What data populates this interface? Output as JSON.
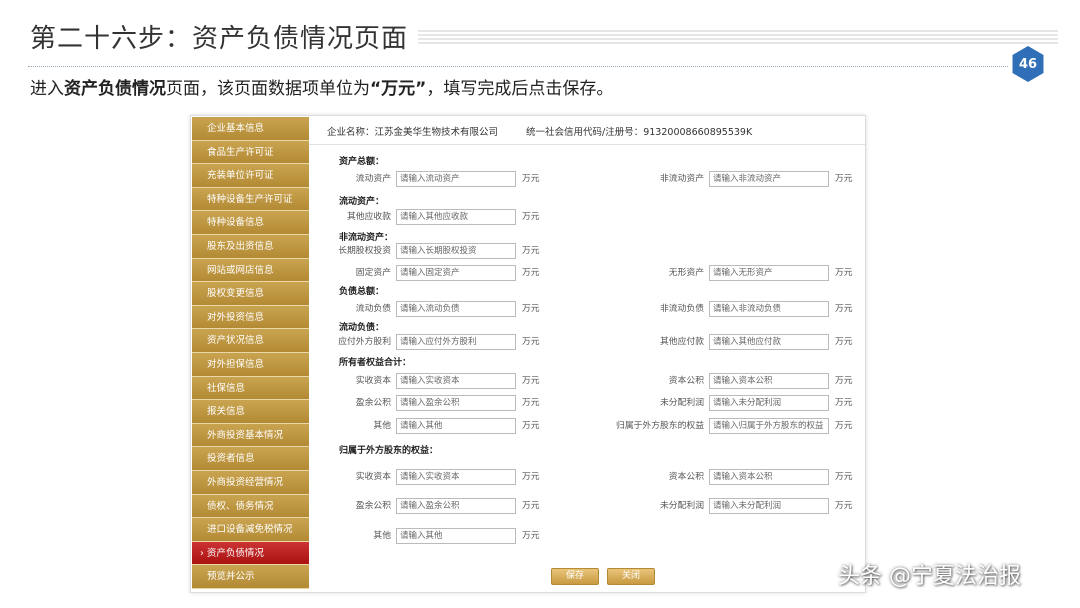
{
  "slide": {
    "title": "第二十六步：资产负债情况页面",
    "page_number": "46",
    "subtitle_pre": "进入",
    "subtitle_bold1": "资产负债情况",
    "subtitle_mid": "页面，该页面数据项单位为",
    "subtitle_bold2": "“万元”",
    "subtitle_post": "，填写完成后点击保存。"
  },
  "sidebar": {
    "items": [
      "企业基本信息",
      "食品生产许可证",
      "充装单位许可证",
      "特种设备生产许可证",
      "特种设备信息",
      "股东及出资信息",
      "网站或网店信息",
      "股权变更信息",
      "对外投资信息",
      "资产状况信息",
      "对外担保信息",
      "社保信息",
      "报关信息",
      "外商投资基本情况",
      "投资者信息",
      "外商投资经营情况",
      "债权、债务情况",
      "进口设备减免税情况",
      "资产负债情况",
      "预览并公示"
    ],
    "active_index": 18
  },
  "info": {
    "company_label": "企业名称：江苏金美华生物技术有限公司",
    "credit_label": "统一社会信用代码/注册号：91320008660895539K"
  },
  "form": {
    "unit": "万元",
    "sections": {
      "s1": "资产总额：",
      "s2": "流动资产：",
      "s3": "非流动资产：",
      "s4": "负债总额：",
      "s5": "流动负债：",
      "s6": "所有者权益合计：",
      "s7": "归属于外方股东的权益："
    },
    "fields": {
      "r1a": {
        "label": "流动资产",
        "placeholder": "请输入流动资产"
      },
      "r1b": {
        "label": "非流动资产",
        "placeholder": "请输入非流动资产"
      },
      "r2a": {
        "label": "其他应收款",
        "placeholder": "请输入其他应收款"
      },
      "r3a": {
        "label": "长期股权投资",
        "placeholder": "请输入长期股权投资"
      },
      "r4a": {
        "label": "固定资产",
        "placeholder": "请输入固定资产"
      },
      "r4b": {
        "label": "无形资产",
        "placeholder": "请输入无形资产"
      },
      "r5a": {
        "label": "流动负债",
        "placeholder": "请输入流动负债"
      },
      "r5b": {
        "label": "非流动负债",
        "placeholder": "请输入非流动负债"
      },
      "r6a": {
        "label": "应付外方股利",
        "placeholder": "请输入应付外方股利"
      },
      "r6b": {
        "label": "其他应付款",
        "placeholder": "请输入其他应付款"
      },
      "r7a": {
        "label": "实收资本",
        "placeholder": "请输入实收资本"
      },
      "r7b": {
        "label": "资本公积",
        "placeholder": "请输入资本公积"
      },
      "r8a": {
        "label": "盈余公积",
        "placeholder": "请输入盈余公积"
      },
      "r8b": {
        "label": "未分配利润",
        "placeholder": "请输入未分配利润"
      },
      "r9a": {
        "label": "其他",
        "placeholder": "请输入其他"
      },
      "r9b": {
        "label": "归属于外方股东的权益",
        "placeholder": "请输入归属于外方股东的权益"
      },
      "r10a": {
        "label": "实收资本",
        "placeholder": "请输入实收资本"
      },
      "r10b": {
        "label": "资本公积",
        "placeholder": "请输入资本公积"
      },
      "r11a": {
        "label": "盈余公积",
        "placeholder": "请输入盈余公积"
      },
      "r11b": {
        "label": "未分配利润",
        "placeholder": "请输入未分配利润"
      },
      "r12a": {
        "label": "其他",
        "placeholder": "请输入其他"
      }
    },
    "save_label": "保存",
    "close_label": "关闭"
  },
  "watermark": "头条 @宁夏法治报",
  "colors": {
    "sidebar_gold": "#b48a34",
    "sidebar_active": "#aa1111",
    "badge_blue": "#2f6fb8",
    "button_gold": "#c89a42"
  }
}
